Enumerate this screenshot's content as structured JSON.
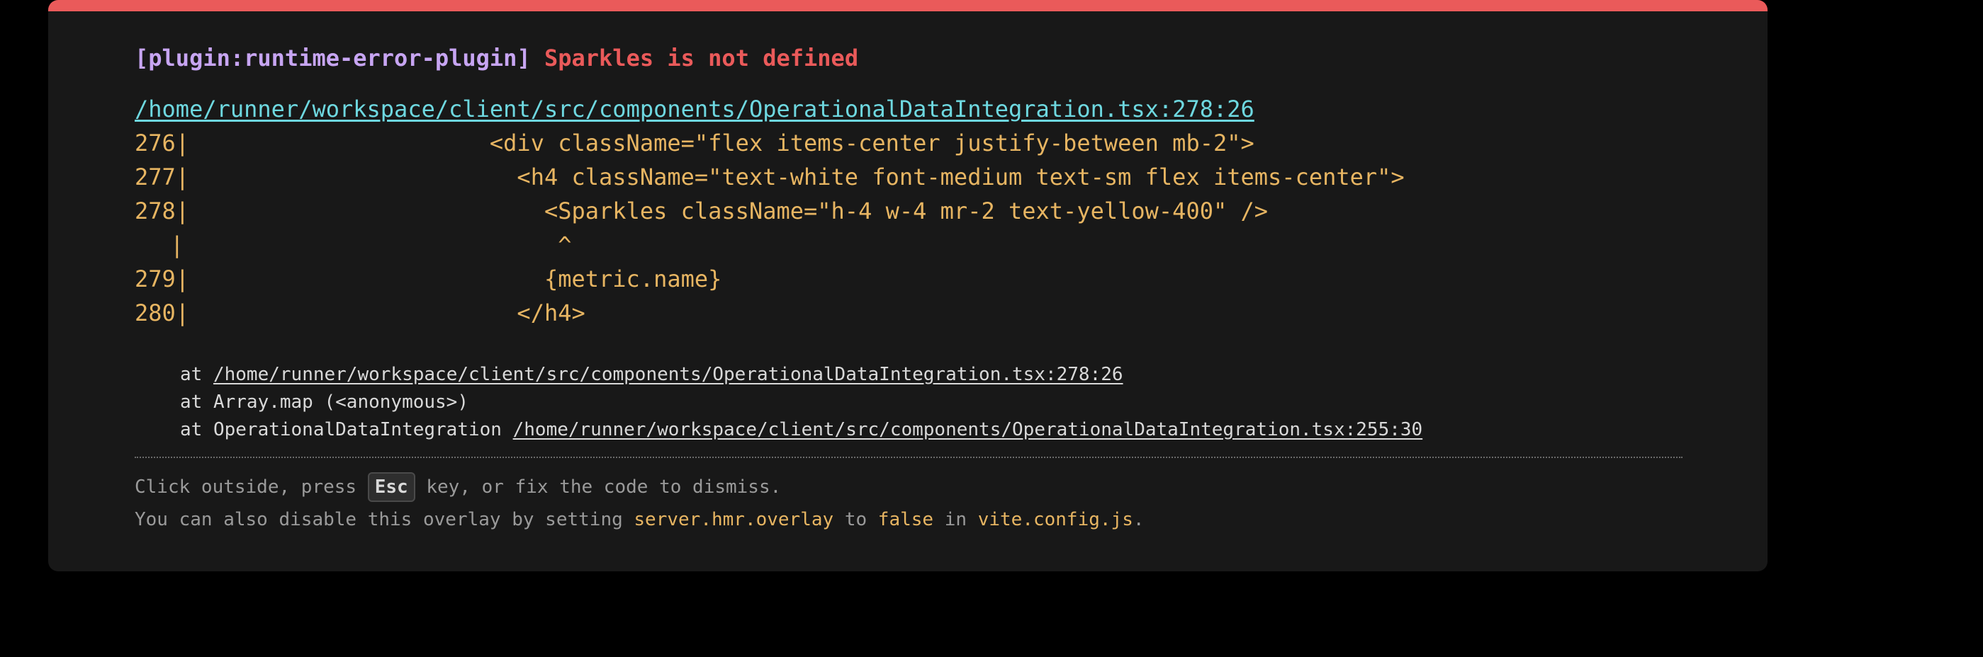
{
  "error": {
    "plugin_tag": "[plugin:runtime-error-plugin]",
    "message": "Sparkles is not defined",
    "file_link": "/home/runner/workspace/client/src/components/OperationalDataIntegration.tsx:278:26"
  },
  "code_frame": {
    "lines": [
      {
        "num": "276",
        "code": "                      <div className=\"flex items-center justify-between mb-2\">"
      },
      {
        "num": "277",
        "code": "                        <h4 className=\"text-white font-medium text-sm flex items-center\">"
      },
      {
        "num": "278",
        "code": "                          <Sparkles className=\"h-4 w-4 mr-2 text-yellow-400\" />"
      },
      {
        "num": "",
        "code": "                           ^"
      },
      {
        "num": "279",
        "code": "                          {metric.name}"
      },
      {
        "num": "280",
        "code": "                        </h4>"
      }
    ]
  },
  "stack": {
    "line1_prefix": "at ",
    "line1_link": "/home/runner/workspace/client/src/components/OperationalDataIntegration.tsx:278:26",
    "line2": "at Array.map (<anonymous>)",
    "line3_prefix": "at OperationalDataIntegration ",
    "line3_link": "/home/runner/workspace/client/src/components/OperationalDataIntegration.tsx:255:30"
  },
  "tip": {
    "line1_before": "Click outside, press ",
    "line1_key": "Esc",
    "line1_after": " key, or fix the code to dismiss.",
    "line2_before": "You can also disable this overlay by setting ",
    "line2_setting": "server.hmr.overlay",
    "line2_mid": " to ",
    "line2_value": "false",
    "line2_in": " in ",
    "line2_file": "vite.config.js",
    "line2_end": "."
  },
  "colors": {
    "accent_bar": "#ea5a5a",
    "plugin_tag": "#c7a5f2",
    "error_message": "#ea5a5a",
    "file_link": "#6ed8e0",
    "code": "#e7b562",
    "background": "#181818"
  }
}
